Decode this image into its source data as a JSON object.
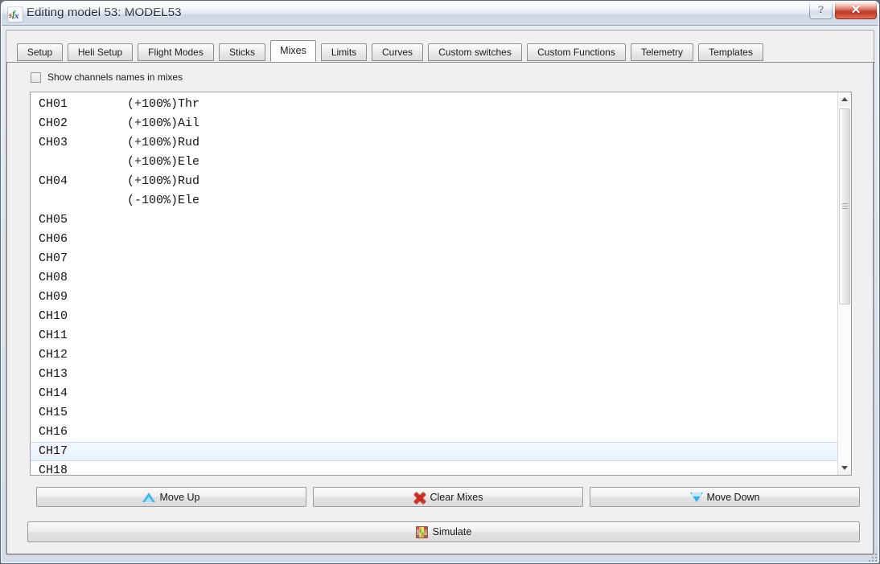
{
  "window": {
    "title": "Editing model 53: MODEL53",
    "app_icon": "eepe-app-icon",
    "help_label": "?",
    "close_label": "✕"
  },
  "tabs": [
    {
      "label": "Setup",
      "active": false
    },
    {
      "label": "Heli Setup",
      "active": false
    },
    {
      "label": "Flight Modes",
      "active": false
    },
    {
      "label": "Sticks",
      "active": false
    },
    {
      "label": "Mixes",
      "active": true
    },
    {
      "label": "Limits",
      "active": false
    },
    {
      "label": "Curves",
      "active": false
    },
    {
      "label": "Custom switches",
      "active": false
    },
    {
      "label": "Custom Functions",
      "active": false
    },
    {
      "label": "Telemetry",
      "active": false
    },
    {
      "label": "Templates",
      "active": false
    }
  ],
  "options": {
    "show_channel_names_label": "Show channels names in mixes",
    "show_channel_names_checked": false
  },
  "mix_list": {
    "selected_index": 18,
    "rows": [
      {
        "channel": "CH01",
        "mix": "(+100%)Thr"
      },
      {
        "channel": "CH02",
        "mix": "(+100%)Ail"
      },
      {
        "channel": "CH03",
        "mix": "(+100%)Rud"
      },
      {
        "channel": "",
        "mix": "(+100%)Ele"
      },
      {
        "channel": "CH04",
        "mix": "(+100%)Rud"
      },
      {
        "channel": "",
        "mix": "(-100%)Ele"
      },
      {
        "channel": "CH05",
        "mix": ""
      },
      {
        "channel": "CH06",
        "mix": ""
      },
      {
        "channel": "CH07",
        "mix": ""
      },
      {
        "channel": "CH08",
        "mix": ""
      },
      {
        "channel": "CH09",
        "mix": ""
      },
      {
        "channel": "CH10",
        "mix": ""
      },
      {
        "channel": "CH11",
        "mix": ""
      },
      {
        "channel": "CH12",
        "mix": ""
      },
      {
        "channel": "CH13",
        "mix": ""
      },
      {
        "channel": "CH14",
        "mix": ""
      },
      {
        "channel": "CH15",
        "mix": ""
      },
      {
        "channel": "CH16",
        "mix": ""
      },
      {
        "channel": "CH17",
        "mix": ""
      },
      {
        "channel": "CH18",
        "mix": ""
      }
    ]
  },
  "scrollbar": {
    "up_arrow": "scroll-up-arrow",
    "down_arrow": "scroll-down-arrow"
  },
  "buttons": {
    "move_up": {
      "label": "Move Up",
      "icon": "triangle-up-icon"
    },
    "clear_mixes": {
      "label": "Clear Mixes",
      "icon": "red-x-icon"
    },
    "move_down": {
      "label": "Move Down",
      "icon": "triangle-down-icon"
    },
    "simulate": {
      "label": "Simulate",
      "icon": "simulate-grid-icon"
    }
  },
  "colors": {
    "selection": "#e8f1fb",
    "selection_border": "#c6d8ef",
    "close_button": "#c8341d",
    "move_icon": "#3fb6ec",
    "clear_icon": "#d42a1f"
  }
}
